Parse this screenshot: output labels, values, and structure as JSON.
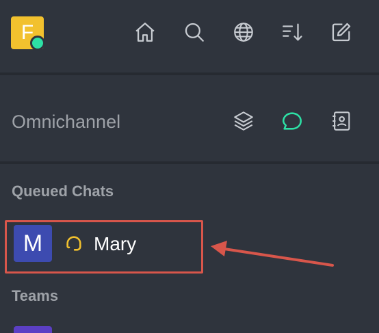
{
  "user": {
    "avatar_letter": "F",
    "status_color": "#2de0a5"
  },
  "header": {
    "icons": [
      "home-icon",
      "search-icon",
      "globe-icon",
      "sort-icon",
      "edit-icon"
    ]
  },
  "omnichannel": {
    "title": "Omnichannel",
    "icons": [
      "layers-icon",
      "chat-icon",
      "contact-book-icon"
    ],
    "active_color": "#2de0a5"
  },
  "queued": {
    "label": "Queued Chats",
    "rooms": [
      {
        "avatar_letter": "M",
        "name": "Mary",
        "icon": "headset-icon",
        "icon_color": "#f2c12e"
      }
    ]
  },
  "teams": {
    "label": "Teams"
  },
  "annotation": {
    "color": "#d8564b"
  }
}
